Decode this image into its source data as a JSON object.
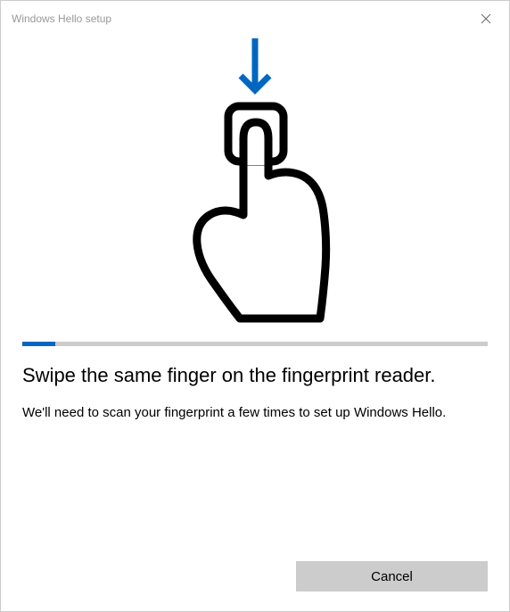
{
  "titlebar": {
    "title": "Windows Hello setup"
  },
  "progress": {
    "percent": 7
  },
  "main": {
    "heading": "Swipe the same finger on the fingerprint reader.",
    "body": "We'll need to scan your fingerprint a few times to set up Windows Hello."
  },
  "buttons": {
    "cancel": "Cancel"
  },
  "colors": {
    "accent": "#0067c0"
  }
}
